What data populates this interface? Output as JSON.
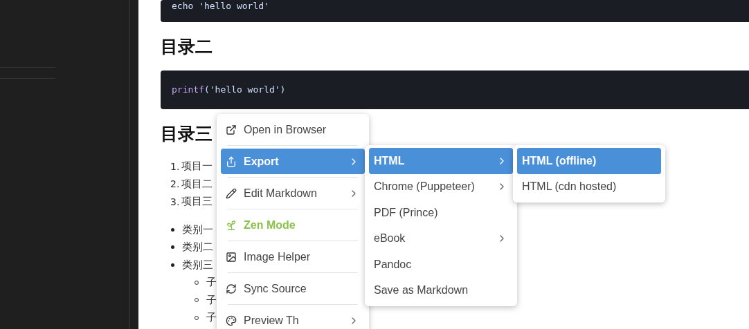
{
  "document": {
    "blocks": [
      {
        "kind": "code",
        "tokens": [
          {
            "text": "echo 'hello world'",
            "color": "#cfe0ff"
          }
        ]
      },
      {
        "kind": "heading",
        "text": "目录二"
      },
      {
        "kind": "code",
        "tokens": [
          {
            "text": "printf",
            "color": "#c7a6f5"
          },
          {
            "text": "('hello world')",
            "color": "#cfe0ff"
          }
        ]
      },
      {
        "kind": "heading",
        "text": "目录三"
      },
      {
        "kind": "ordered",
        "items": [
          {
            "marker": "1.",
            "text": "项目一"
          },
          {
            "marker": "2.",
            "text": "项目二"
          },
          {
            "marker": "3.",
            "text": "项目三"
          }
        ]
      },
      {
        "kind": "bullets",
        "items": [
          {
            "text": "类别一"
          },
          {
            "text": "类别二"
          },
          {
            "text": "类别三",
            "children": [
              {
                "text": "子"
              },
              {
                "text": "子"
              },
              {
                "text": "子"
              }
            ]
          }
        ]
      }
    ]
  },
  "main_menu": {
    "items": [
      {
        "label": "Open in Browser",
        "submenu": false,
        "selected": false
      },
      {
        "label": "Export",
        "submenu": true,
        "selected": true
      },
      {
        "label": "Edit Markdown",
        "submenu": true,
        "selected": false
      },
      {
        "label": "Zen Mode",
        "submenu": false,
        "selected": false,
        "color": "#8bc34a"
      },
      {
        "label": "Image Helper",
        "submenu": false,
        "selected": false
      },
      {
        "label": "Sync Source",
        "submenu": false,
        "selected": false
      },
      {
        "label": "Preview Th",
        "submenu": true,
        "selected": false
      }
    ]
  },
  "export_menu": {
    "items": [
      {
        "label": "HTML",
        "submenu": true,
        "selected": true
      },
      {
        "label": "Chrome (Puppeteer)",
        "submenu": true,
        "selected": false
      },
      {
        "label": "PDF (Prince)",
        "submenu": false,
        "selected": false
      },
      {
        "label": "eBook",
        "submenu": true,
        "selected": false
      },
      {
        "label": "Pandoc",
        "submenu": false,
        "selected": false
      },
      {
        "label": "Save as Markdown",
        "submenu": false,
        "selected": false
      }
    ]
  },
  "html_menu": {
    "items": [
      {
        "label": "HTML (offline)",
        "selected": true
      },
      {
        "label": "HTML (cdn hosted)",
        "selected": false
      }
    ]
  }
}
